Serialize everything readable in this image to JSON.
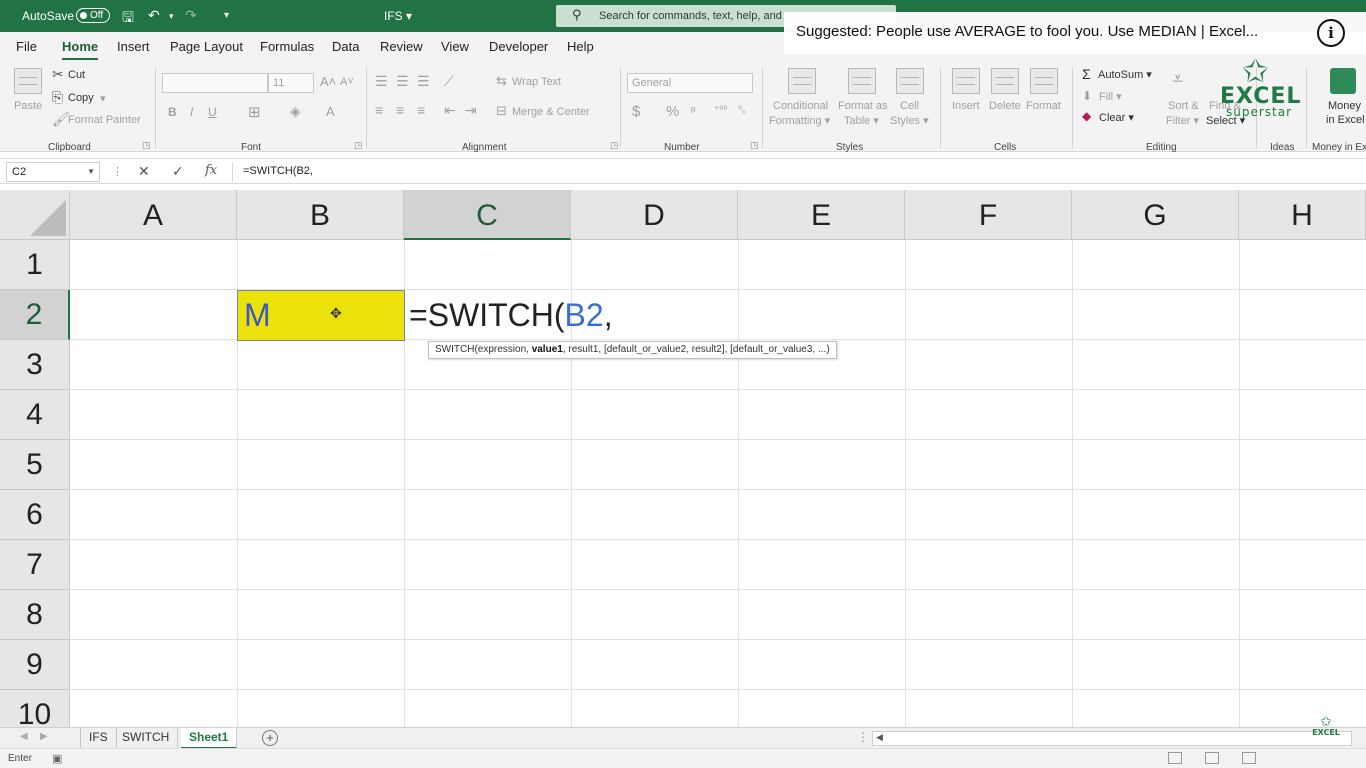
{
  "title_bar": {
    "autosave_label": "AutoSave",
    "autosave_state": "Off",
    "doc_title": "IFS",
    "search_placeholder": "Search for commands, text, help, and"
  },
  "suggestion_overlay": {
    "text": "Suggested: People use AVERAGE to fool you. Use MEDIAN | Excel..."
  },
  "menu_tabs": [
    "File",
    "Home",
    "Insert",
    "Page Layout",
    "Formulas",
    "Data",
    "Review",
    "View",
    "Developer",
    "Help"
  ],
  "active_menu_tab": "Home",
  "ribbon": {
    "clipboard": {
      "paste": "Paste",
      "cut": "Cut",
      "copy": "Copy",
      "format_painter": "Format Painter",
      "group": "Clipboard"
    },
    "font": {
      "font_size": "11",
      "group": "Font"
    },
    "alignment": {
      "wrap_text": "Wrap Text",
      "merge_center": "Merge & Center",
      "group": "Alignment"
    },
    "number": {
      "format": "General",
      "group": "Number"
    },
    "styles": {
      "conditional_1": "Conditional",
      "conditional_2": "Formatting",
      "format_as_1": "Format as",
      "format_as_2": "Table",
      "cell_styles_1": "Cell",
      "cell_styles_2": "Styles",
      "group": "Styles"
    },
    "cells": {
      "insert": "Insert",
      "delete": "Delete",
      "format": "Format",
      "group": "Cells"
    },
    "editing": {
      "autosum": "AutoSum",
      "fill": "Fill",
      "clear": "Clear",
      "sort_1": "Sort &",
      "sort_2": "Filter",
      "find_1": "Find &",
      "find_2": "Select",
      "group": "Editing"
    },
    "ideas": {
      "group": "Ideas"
    },
    "money": {
      "label_1": "Money",
      "label_2": "in Excel",
      "group": "Money in Ex"
    }
  },
  "logo": {
    "line1": "EXCEL",
    "line2": "superstar"
  },
  "formula_bar": {
    "name_box": "C2",
    "cancel_icon": "✕",
    "enter_icon": "✓",
    "fx": "fx",
    "formula": "=SWITCH(B2,"
  },
  "grid": {
    "columns": [
      "A",
      "B",
      "C",
      "D",
      "E",
      "F",
      "G",
      "H"
    ],
    "rows": [
      "1",
      "2",
      "3",
      "4",
      "5",
      "6",
      "7",
      "8",
      "9",
      "10"
    ],
    "selected_column": "C",
    "selected_row": "2",
    "cell_B2": "M",
    "cell_C2_prefix": "=SWITCH(",
    "cell_C2_ref": "B2",
    "cell_C2_suffix": ",",
    "cell_B2_fill": "#ece10b"
  },
  "tooltip": {
    "prefix": "SWITCH(expression, ",
    "bold": "value1",
    "suffix": ", result1, [default_or_value2, result2], [default_or_value3, ...)"
  },
  "sheet_tabs": [
    "IFS",
    "SWITCH",
    "Sheet1"
  ],
  "active_sheet": "Sheet1",
  "status_bar": {
    "mode": "Enter"
  },
  "colors": {
    "excel_green": "#217346",
    "selection_border": "#6d86b6",
    "reference_blue": "#3b6fc9"
  }
}
